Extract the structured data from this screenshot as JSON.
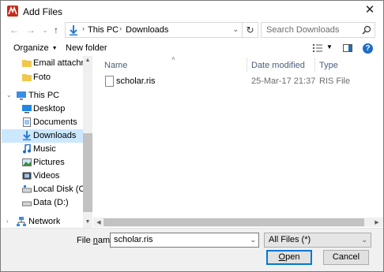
{
  "window": {
    "title": "Add Files",
    "close_glyph": "✕",
    "app_icon": "app-logo-icon"
  },
  "nav": {
    "back_glyph": "←",
    "forward_glyph": "→",
    "dropdown_glyph": "⌄",
    "up_glyph": "↑",
    "breadcrumb": [
      "This PC",
      "Downloads"
    ],
    "crumb_separator": "›",
    "addr_dropdown_glyph": "⌄",
    "refresh_glyph": "↻",
    "search_placeholder": "Search Downloads"
  },
  "toolbar": {
    "organize_label": "Organize",
    "caret_glyph": "▼",
    "new_folder_label": "New folder",
    "view_dropdown_glyph": "▼",
    "help_glyph": "?"
  },
  "sidebar": {
    "items": [
      {
        "label": "Email attachmen",
        "icon": "folder-icon",
        "indent": 1
      },
      {
        "label": "Foto",
        "icon": "folder-icon",
        "indent": 1
      },
      {
        "label": "This PC",
        "icon": "computer-icon",
        "indent": 0,
        "expand": "⌄"
      },
      {
        "label": "Desktop",
        "icon": "desktop-icon",
        "indent": 1
      },
      {
        "label": "Documents",
        "icon": "documents-icon",
        "indent": 1
      },
      {
        "label": "Downloads",
        "icon": "downloads-icon",
        "indent": 1,
        "selected": true
      },
      {
        "label": "Music",
        "icon": "music-icon",
        "indent": 1
      },
      {
        "label": "Pictures",
        "icon": "pictures-icon",
        "indent": 1
      },
      {
        "label": "Videos",
        "icon": "videos-icon",
        "indent": 1
      },
      {
        "label": "Local Disk (C:)",
        "icon": "drive-icon",
        "indent": 1
      },
      {
        "label": "Data (D:)",
        "icon": "drive-icon",
        "indent": 1
      },
      {
        "label": "Network",
        "icon": "network-icon",
        "indent": 0,
        "expand": "›"
      }
    ]
  },
  "columns": {
    "name": "Name",
    "date": "Date modified",
    "type": "Type",
    "sort_glyph": "˄"
  },
  "files": [
    {
      "name": "scholar.ris",
      "date": "25-Mar-17 21:37",
      "type": "RIS File"
    }
  ],
  "scroll": {
    "up": "▲",
    "down": "▼",
    "left": "◀",
    "right": "▶"
  },
  "footer": {
    "filename_label_prefix": "File ",
    "filename_label_key": "n",
    "filename_label_suffix": "ame:",
    "filename_value": "scholar.ris",
    "filename_dropdown_glyph": "⌄",
    "filetype_value": "All Files  (*)",
    "filetype_dropdown_glyph": "⌄",
    "open_key": "O",
    "open_rest": "pen",
    "cancel_label": "Cancel"
  },
  "colors": {
    "selection": "#cce8ff",
    "accent": "#0078d7",
    "header_text": "#4c607a"
  }
}
